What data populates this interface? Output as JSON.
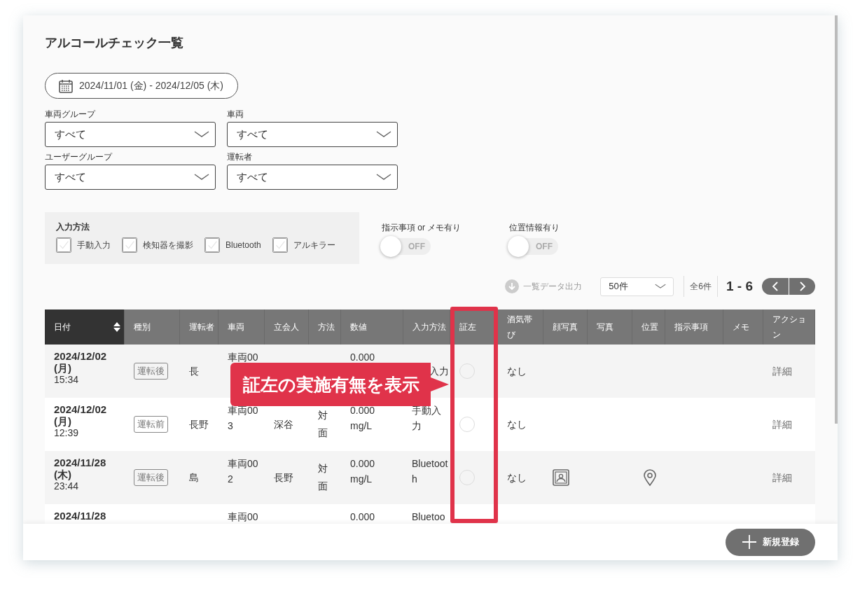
{
  "page": {
    "title": "アルコールチェック一覧"
  },
  "date_range": {
    "value": "2024/11/01 (金) - 2024/12/05 (木)"
  },
  "filters": [
    {
      "label": "車両グループ",
      "value": "すべて"
    },
    {
      "label": "車両",
      "value": "すべて"
    },
    {
      "label": "ユーザーグループ",
      "value": "すべて"
    },
    {
      "label": "運転者",
      "value": "すべて"
    }
  ],
  "input_method_filter": {
    "title": "入力方法",
    "options": [
      {
        "label": "手動入力",
        "checked": false
      },
      {
        "label": "検知器を撮影",
        "checked": false
      },
      {
        "label": "Bluetooth",
        "checked": false
      },
      {
        "label": "アルキラー",
        "checked": false
      }
    ]
  },
  "toggles": [
    {
      "label": "指示事項 or メモ有り",
      "on": false,
      "state_label": "OFF"
    },
    {
      "label": "位置情報有り",
      "on": false,
      "state_label": "OFF"
    }
  ],
  "toolbar": {
    "export": {
      "label": "一覧データ出力",
      "disabled": true
    },
    "per_page": "50件",
    "total": "全6件",
    "range": "1 - 6"
  },
  "table": {
    "columns": [
      {
        "label": "日付",
        "sorted": true,
        "highlighted": false
      },
      {
        "label": "種別",
        "sorted": false,
        "highlighted": false
      },
      {
        "label": "運転者",
        "sorted": false,
        "highlighted": false
      },
      {
        "label": "車両",
        "sorted": false,
        "highlighted": false
      },
      {
        "label": "立会人",
        "sorted": false,
        "highlighted": false
      },
      {
        "label": "方法",
        "sorted": false,
        "highlighted": false
      },
      {
        "label": "数値",
        "sorted": false,
        "highlighted": false
      },
      {
        "label": "入力方法",
        "sorted": false,
        "highlighted": false
      },
      {
        "label": "証左",
        "sorted": false,
        "highlighted": true
      },
      {
        "label": "酒気帯び",
        "sorted": false,
        "highlighted": false
      },
      {
        "label": "顔写真",
        "sorted": false,
        "highlighted": false
      },
      {
        "label": "写真",
        "sorted": false,
        "highlighted": false
      },
      {
        "label": "位置",
        "sorted": false,
        "highlighted": false
      },
      {
        "label": "指示事項",
        "sorted": false,
        "highlighted": false
      },
      {
        "label": "メモ",
        "sorted": false,
        "highlighted": false
      },
      {
        "label": "アクション",
        "sorted": false,
        "highlighted": false
      }
    ],
    "rows": [
      {
        "date": "2024/12/02",
        "weekday": "(月)",
        "time": "15:34",
        "type": "運転後",
        "driver": "長",
        "vehicle": "車両00",
        "value": "0.000",
        "input_method": "入力",
        "input_method_tail": true,
        "evidence": false,
        "alcohol": "なし",
        "face_photo": false,
        "location": false,
        "action": "詳細"
      },
      {
        "date": "2024/12/02",
        "weekday": "(月)",
        "time": "12:39",
        "type": "運転前",
        "driver": "長野",
        "vehicle": "車両003",
        "witness": "深谷",
        "method": "対面",
        "value": "0.000 mg/L",
        "input_method": "手動入力",
        "input_method_tail": false,
        "evidence": false,
        "alcohol": "なし",
        "face_photo": false,
        "location": false,
        "action": "詳細"
      },
      {
        "date": "2024/11/28",
        "weekday": "(木)",
        "time": "23:44",
        "type": "運転後",
        "driver": "島",
        "vehicle": "車両002",
        "witness": "長野",
        "method": "対面",
        "value": "0.000 mg/L",
        "input_method": "Bluetooth",
        "input_method_tail": false,
        "evidence": false,
        "alcohol": "なし",
        "face_photo": true,
        "location": true,
        "action": "詳細"
      },
      {
        "date": "2024/11/28",
        "vehicle": "車両00",
        "value": "0.000",
        "input_method": "Bluetoo",
        "input_method_tail": false
      }
    ]
  },
  "callout": {
    "text": "証左の実施有無を表示"
  },
  "create_button": {
    "label": "新規登録"
  }
}
